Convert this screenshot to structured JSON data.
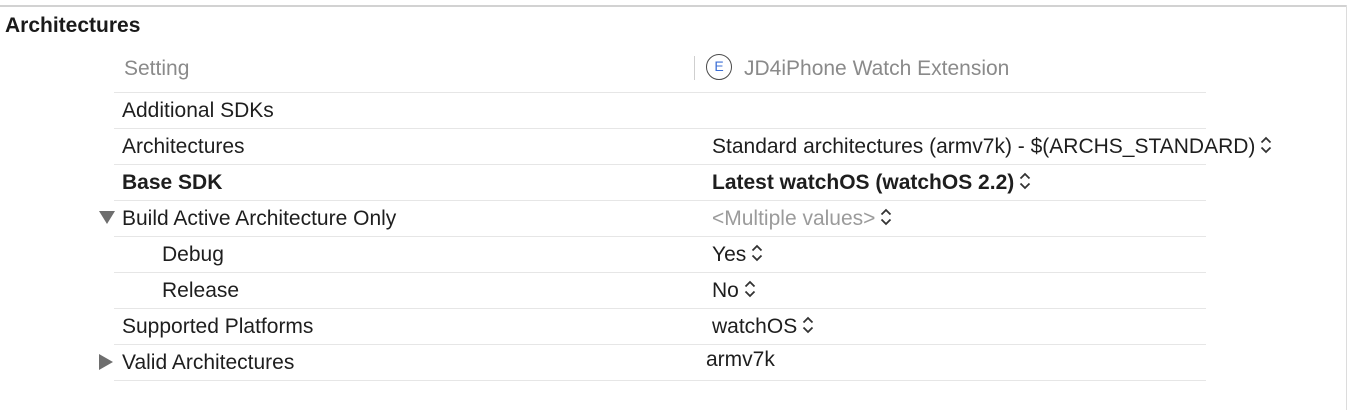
{
  "section": {
    "title": "Architectures"
  },
  "header": {
    "setting_label": "Setting",
    "target_icon_letter": "E",
    "target_name": "JD4iPhone Watch Extension"
  },
  "rows": [
    {
      "name": "Additional SDKs",
      "value": ""
    },
    {
      "name": "Architectures",
      "value": "Standard architectures (armv7k)  -  $(ARCHS_STANDARD)"
    },
    {
      "name": "Base SDK",
      "value": "Latest watchOS (watchOS 2.2)"
    },
    {
      "name": "Build Active Architecture Only",
      "value": "<Multiple values>",
      "disclosure": "expanded"
    },
    {
      "name": "Debug",
      "value": "Yes"
    },
    {
      "name": "Release",
      "value": "No"
    },
    {
      "name": "Supported Platforms",
      "value": "watchOS"
    },
    {
      "name": "Valid Architectures",
      "value": "armv7k",
      "disclosure": "collapsed"
    }
  ],
  "icons": {
    "expanded": "disclosure-triangle-down-icon",
    "collapsed": "disclosure-triangle-right-icon",
    "popup": "popup-chevron-icon"
  }
}
